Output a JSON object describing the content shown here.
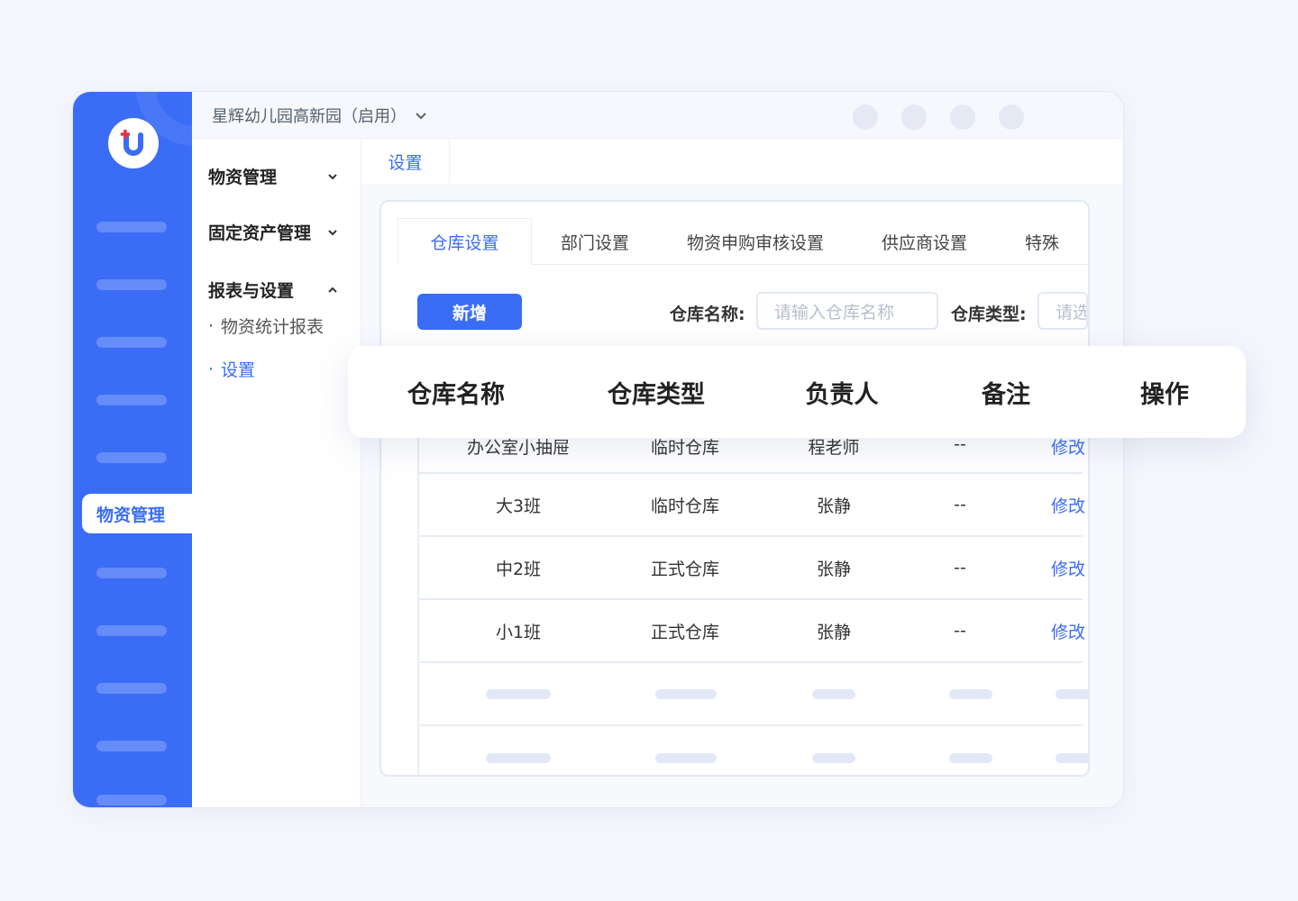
{
  "app": {
    "school_name": "星辉幼儿园高新园（启用）",
    "rail_active_label": "物资管理"
  },
  "colors": {
    "primary": "#3a6cf6",
    "rail": "#3a6cf6",
    "logo_accent": "#e8323c"
  },
  "submenu": {
    "groups": [
      {
        "label": "物资管理",
        "expanded": false
      },
      {
        "label": "固定资产管理",
        "expanded": false
      },
      {
        "label": "报表与设置",
        "expanded": true
      }
    ],
    "items": [
      {
        "label": "物资统计报表",
        "active": false
      },
      {
        "label": "设置",
        "active": true
      }
    ]
  },
  "breadcrumb": {
    "tab": "设置"
  },
  "tabs": [
    "仓库设置",
    "部门设置",
    "物资申购审核设置",
    "供应商设置",
    "特殊"
  ],
  "toolbar": {
    "add_label": "新增",
    "filter_name_label": "仓库名称:",
    "filter_name_placeholder": "请输入仓库名称",
    "filter_type_label": "仓库类型:",
    "filter_type_placeholder": "请选择"
  },
  "table": {
    "columns": [
      "仓库名称",
      "仓库类型",
      "负责人",
      "备注",
      "操作"
    ],
    "rows": [
      {
        "name": "办公室小抽屉",
        "type": "临时仓库",
        "owner": "程老师",
        "note": "--",
        "action": "修改"
      },
      {
        "name": "大3班",
        "type": "临时仓库",
        "owner": "张静",
        "note": "--",
        "action": "修改"
      },
      {
        "name": "中2班",
        "type": "正式仓库",
        "owner": "张静",
        "note": "--",
        "action": "修改"
      },
      {
        "name": "小1班",
        "type": "正式仓库",
        "owner": "张静",
        "note": "--",
        "action": "修改"
      }
    ]
  },
  "icons": {
    "logo": "brand-logo-icon",
    "chevron_down": "chevron-down-icon",
    "chevron_up": "chevron-up-icon",
    "avatar": "user-avatar"
  }
}
